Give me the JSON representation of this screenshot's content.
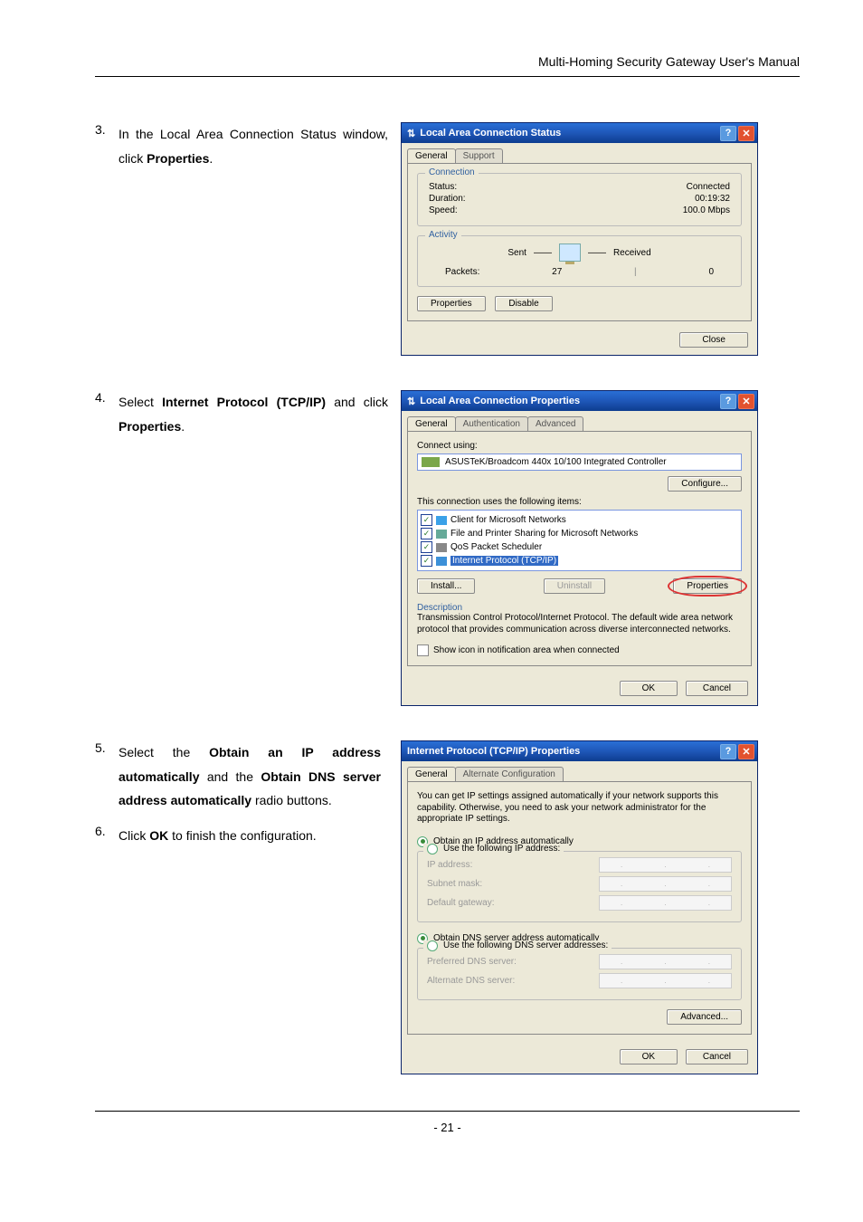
{
  "header": {
    "title": "Multi-Homing Security Gateway User's Manual"
  },
  "page_number": "- 21 -",
  "steps": {
    "s3": {
      "num": "3.",
      "text_a": "In the Local Area Connection Status window, click ",
      "bold": "Properties",
      "text_b": "."
    },
    "s4": {
      "num": "4.",
      "text_a": "Select ",
      "bold1": "Internet Protocol (TCP/IP)",
      "text_b": " and click ",
      "bold2": "Properties",
      "text_c": "."
    },
    "s5": {
      "num": "5.",
      "text_a": "Select the ",
      "bold1": "Obtain an IP address automatically",
      "text_b": " and the ",
      "bold2": "Obtain DNS server address automatically",
      "text_c": " radio buttons."
    },
    "s6": {
      "num": "6.",
      "text_a": "Click ",
      "bold": "OK",
      "text_b": " to finish the configuration."
    }
  },
  "dlg_status": {
    "title": "Local Area Connection Status",
    "tabs": {
      "general": "General",
      "support": "Support"
    },
    "grp_conn": "Connection",
    "status_lbl": "Status:",
    "status_val": "Connected",
    "duration_lbl": "Duration:",
    "duration_val": "00:19:32",
    "speed_lbl": "Speed:",
    "speed_val": "100.0 Mbps",
    "grp_act": "Activity",
    "sent": "Sent",
    "received": "Received",
    "packets_lbl": "Packets:",
    "packets_sent": "27",
    "packets_recv": "0",
    "btn_props": "Properties",
    "btn_disable": "Disable",
    "btn_close": "Close"
  },
  "dlg_props": {
    "title": "Local Area Connection Properties",
    "tabs": {
      "general": "General",
      "auth": "Authentication",
      "adv": "Advanced"
    },
    "connect_using": "Connect using:",
    "adapter": "ASUSTeK/Broadcom 440x 10/100 Integrated Controller",
    "btn_configure": "Configure...",
    "uses_items": "This connection uses the following items:",
    "items": {
      "i1": "Client for Microsoft Networks",
      "i2": "File and Printer Sharing for Microsoft Networks",
      "i3": "QoS Packet Scheduler",
      "i4": "Internet Protocol (TCP/IP)"
    },
    "btn_install": "Install...",
    "btn_uninstall": "Uninstall",
    "btn_properties": "Properties",
    "desc_title": "Description",
    "desc_text": "Transmission Control Protocol/Internet Protocol. The default wide area network protocol that provides communication across diverse interconnected networks.",
    "show_icon": "Show icon in notification area when connected",
    "btn_ok": "OK",
    "btn_cancel": "Cancel"
  },
  "dlg_tcp": {
    "title": "Internet Protocol (TCP/IP) Properties",
    "tabs": {
      "general": "General",
      "alt": "Alternate Configuration"
    },
    "blurb": "You can get IP settings assigned automatically if your network supports this capability. Otherwise, you need to ask your network administrator for the appropriate IP settings.",
    "r1": "Obtain an IP address automatically",
    "r2": "Use the following IP address:",
    "ip_lbl": "IP address:",
    "mask_lbl": "Subnet mask:",
    "gw_lbl": "Default gateway:",
    "r3": "Obtain DNS server address automatically",
    "r4": "Use the following DNS server addresses:",
    "pdns_lbl": "Preferred DNS server:",
    "adns_lbl": "Alternate DNS server:",
    "btn_adv": "Advanced...",
    "btn_ok": "OK",
    "btn_cancel": "Cancel"
  }
}
